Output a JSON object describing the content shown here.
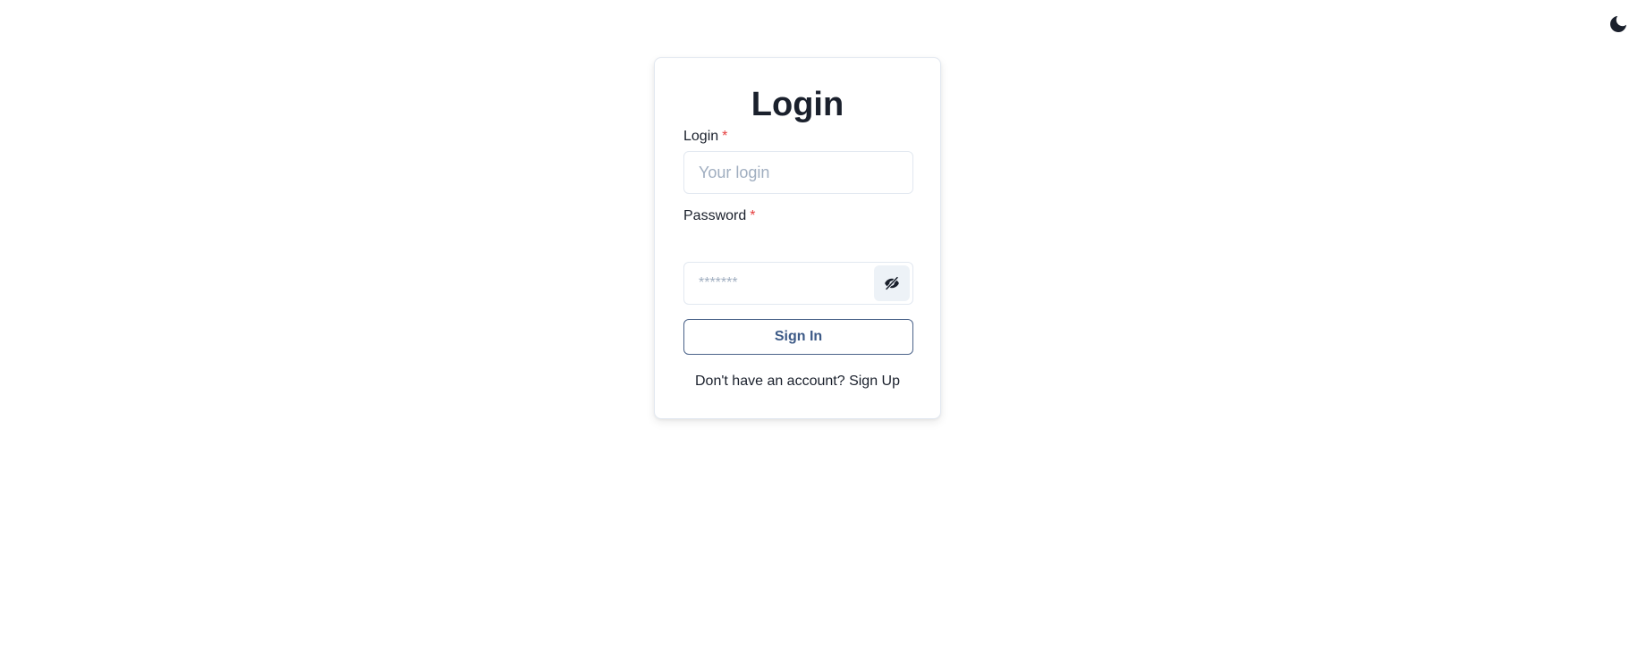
{
  "theme_toggle": {
    "icon": "moon-icon"
  },
  "card": {
    "title": "Login",
    "login_field": {
      "label": "Login",
      "required_mark": "*",
      "placeholder": "Your login",
      "value": ""
    },
    "password_field": {
      "label": "Password",
      "required_mark": "*",
      "placeholder": "*******",
      "value": "",
      "toggle_icon": "eye-off-icon"
    },
    "signin_label": "Sign In",
    "footer": {
      "prompt": "Don't have an account?",
      "link_label": "Sign Up"
    }
  },
  "colors": {
    "accent": "#3d5a87",
    "required": "#e53e3e",
    "border": "#e2e8f0"
  }
}
